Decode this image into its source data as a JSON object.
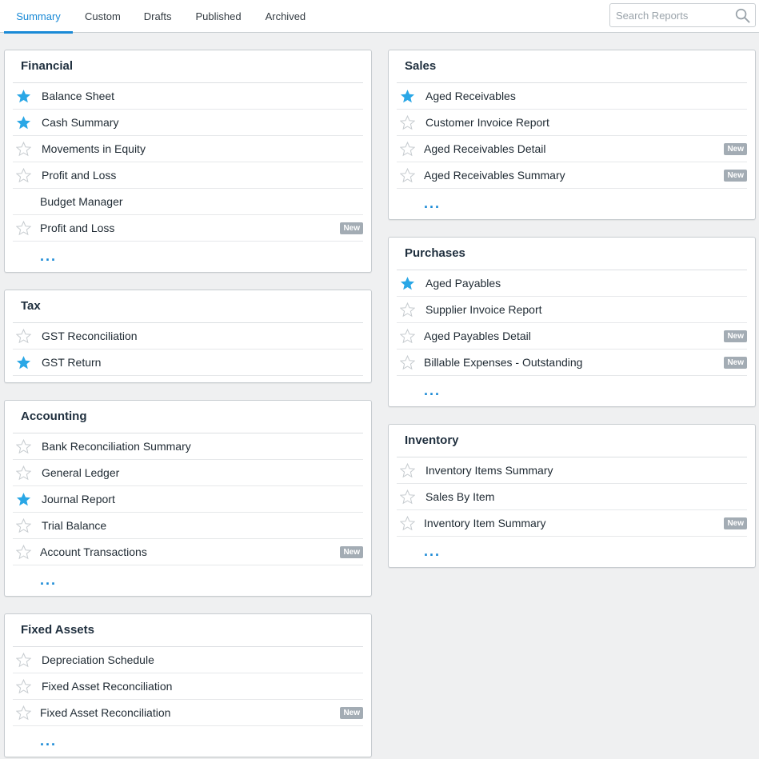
{
  "tabs": [
    "Summary",
    "Custom",
    "Drafts",
    "Published",
    "Archived"
  ],
  "search": {
    "placeholder": "Search Reports"
  },
  "colors": {
    "accent": "#1a8ad6",
    "star_filled": "#2aa7e6",
    "star_empty": "#c8cdd1",
    "badge": "#a3acb4"
  },
  "more_label": "...",
  "sections": {
    "financial": {
      "title": "Financial",
      "rows": [
        {
          "label": "Balance Sheet",
          "starred": true,
          "badge": ""
        },
        {
          "label": "Cash Summary",
          "starred": true,
          "badge": ""
        },
        {
          "label": "Movements in Equity",
          "starred": false,
          "badge": ""
        },
        {
          "label": "Profit and Loss",
          "starred": false,
          "badge": ""
        },
        {
          "label": "Budget Manager",
          "starred": null,
          "badge": ""
        },
        {
          "label": "Profit and Loss",
          "starred": false,
          "badge": "New"
        }
      ]
    },
    "tax": {
      "title": "Tax",
      "rows": [
        {
          "label": "GST Reconciliation",
          "starred": false,
          "badge": ""
        },
        {
          "label": "GST Return",
          "starred": true,
          "badge": ""
        }
      ]
    },
    "accounting": {
      "title": "Accounting",
      "rows": [
        {
          "label": "Bank Reconciliation Summary",
          "starred": false,
          "badge": ""
        },
        {
          "label": "General Ledger",
          "starred": false,
          "badge": ""
        },
        {
          "label": "Journal Report",
          "starred": true,
          "badge": ""
        },
        {
          "label": "Trial Balance",
          "starred": false,
          "badge": ""
        },
        {
          "label": "Account Transactions",
          "starred": false,
          "badge": "New"
        }
      ]
    },
    "fixed_assets": {
      "title": "Fixed Assets",
      "rows": [
        {
          "label": "Depreciation Schedule",
          "starred": false,
          "badge": ""
        },
        {
          "label": "Fixed Asset Reconciliation",
          "starred": false,
          "badge": ""
        },
        {
          "label": "Fixed Asset Reconciliation",
          "starred": false,
          "badge": "New"
        }
      ]
    },
    "sales": {
      "title": "Sales",
      "rows": [
        {
          "label": "Aged Receivables",
          "starred": true,
          "badge": ""
        },
        {
          "label": "Customer Invoice Report",
          "starred": false,
          "badge": ""
        },
        {
          "label": "Aged Receivables Detail",
          "starred": false,
          "badge": "New"
        },
        {
          "label": "Aged Receivables Summary",
          "starred": false,
          "badge": "New"
        }
      ]
    },
    "purchases": {
      "title": "Purchases",
      "rows": [
        {
          "label": "Aged Payables",
          "starred": true,
          "badge": ""
        },
        {
          "label": "Supplier Invoice Report",
          "starred": false,
          "badge": ""
        },
        {
          "label": "Aged Payables Detail",
          "starred": false,
          "badge": "New"
        },
        {
          "label": "Billable Expenses - Outstanding",
          "starred": false,
          "badge": "New"
        }
      ]
    },
    "inventory": {
      "title": "Inventory",
      "rows": [
        {
          "label": "Inventory Items Summary",
          "starred": false,
          "badge": ""
        },
        {
          "label": "Sales By Item",
          "starred": false,
          "badge": ""
        },
        {
          "label": "Inventory Item Summary",
          "starred": false,
          "badge": "New"
        }
      ]
    }
  }
}
